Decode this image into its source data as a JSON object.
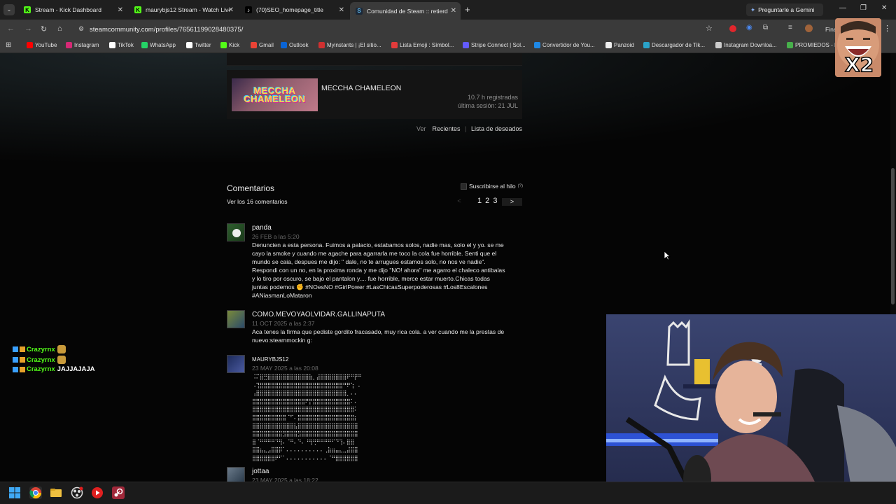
{
  "browser": {
    "tabs": [
      {
        "label": "Stream - Kick Dashboard",
        "favicon": "K",
        "color": "#53fc18"
      },
      {
        "label": "maurybjs12 Stream - Watch Live",
        "favicon": "K",
        "color": "#53fc18"
      },
      {
        "label": "(70)SEO_homepage_title",
        "favicon": "♪",
        "color": "#ffffff"
      },
      {
        "label": "Comunidad de Steam :: retierd",
        "favicon": "S",
        "color": "#66c0f4"
      }
    ],
    "gemini_label": "Preguntarle a Gemini",
    "url": "steamcommunity.com/profiles/76561199028480375/",
    "profile_label": "Fina",
    "bookmarks": [
      {
        "label": "YouTube",
        "color": "#ff0000"
      },
      {
        "label": "Instagram",
        "color": "#d62976"
      },
      {
        "label": "TikTok",
        "color": "#ffffff"
      },
      {
        "label": "WhatsApp",
        "color": "#25d366"
      },
      {
        "label": "Twitter",
        "color": "#ffffff"
      },
      {
        "label": "Kick",
        "color": "#53fc18"
      },
      {
        "label": "Gmail",
        "color": "#ea4335"
      },
      {
        "label": "Outlook",
        "color": "#0a64d6"
      },
      {
        "label": "Myinstants | ¡El sitio...",
        "color": "#d03030"
      },
      {
        "label": "Lista Emoji : Símbol...",
        "color": "#e23b3b"
      },
      {
        "label": "Stripe Connect | Sol...",
        "color": "#635bff"
      },
      {
        "label": "Convertidor de You...",
        "color": "#1e88e5"
      },
      {
        "label": "Panzoid",
        "color": "#eeeeee"
      },
      {
        "label": "Descargador de Tik...",
        "color": "#2aa3c9"
      },
      {
        "label": "Instagram Downloa...",
        "color": "#cccccc"
      },
      {
        "label": "PROMIEDOS - P",
        "color": "#47b04b"
      }
    ]
  },
  "game": {
    "image_text": "MECCHA CHAMELEON",
    "title": "MECCHA CHAMELEON",
    "hours": "10.7 h registradas",
    "last_session": "última sesión: 21 JUL"
  },
  "view_row": {
    "ver": "Ver",
    "recent": "Recientes",
    "wishlist": "Lista de deseados"
  },
  "comments": {
    "title": "Comentarios",
    "subscribe": "Suscribirse al hilo",
    "subscribe_help": "(?)",
    "view_all": "Ver los 16 comentarios",
    "pagination": {
      "prev": "<",
      "pages": "1 2 3",
      "next": ">"
    },
    "items": [
      {
        "author": "panda",
        "date": "26 FEB a las 5:20",
        "lines": [
          "Denuncien a esta persona. Fuimos a palacio, estabamos solos, nadie mas, solo el y yo. se me",
          "cayo la smoke y cuando me agache para agarrarla me toco la cola fue horrible. Senti que el",
          "mundo se caia, despues me dijo: \" dale, no te arrugues estamos solo, no nos ve nadie\".",
          "Respondi con un no, en la proxima ronda y me dijo \"NO! ahora\" me agarro el chaleco antibalas",
          "y lo tiro por oscuro, se bajo el pantalon y.... fue horrible, merce estar muerto.Chicas todas",
          "juntas podemos ✊ #NOesNO #GirlPower #LasChicasSuperpoderosas #Los8Escalones",
          "#ANiasmanLoMataron"
        ]
      },
      {
        "author": "COMO.MEVOYAOLVIDAR.GALLINAPUTA",
        "date": "11 OCT 2025 a las 2:37",
        "lines": [
          "Aca tenes la firma que pediste gordito fracasado, muy rica cola. a ver cuando me la prestas de",
          "nuevo:steammockin g:"
        ]
      },
      {
        "author": "MAURYBJS12",
        "date": "23 MAY 2025 a las 20:08",
        "ascii": [
          "⠨⠍⣿⣛⣿⣿⣿⣿⣿⣿⣿⣿⣿⣿⣿⣷⡀⣼⣿⣿⣿⣿⣿⣿⣿⠟⠛⡟⠛⠀",
          "⠠⢹⣿⣿⣿⣿⣿⣿⣿⣿⣿⣿⣿⣿⣿⣿⣿⣿⣿⣿⣿⣿⣿⣿⠛⠟⢱⠀⠄",
          "⢠⣿⣿⣿⣿⣿⣿⣿⣿⣿⣿⣿⣿⣿⣿⣿⣿⣿⣿⣿⣿⣿⣿⣿⣿⡀⠄⠄",
          "⣿⣿⣿⣿⣿⣿⣿⣿⣿⣿⣿⣿⣿⣿⠟⡟⣿⣿⣿⣿⣿⣿⣿⣿⣿⣿⠅⠄",
          "⣿⣿⣿⣿⣿⣿⣿⣿⣿⣿⣿⣿⣿⣿⣿⣿⣿⣿⣿⣿⣿⣿⣿⣿⣿⣿⣿⠅",
          "⣿⣿⣿⣿⣿⣿⣿⣿⣿⠈⠋⠄⣿⣿⣿⣿⣿⣿⣿⣿⣿⣿⣿⣿⣿⣿⣿⡆",
          "⣿⣿⣿⣿⣿⣿⣿⣿⣿⣿⣿⣧⣿⣿⣿⣿⣿⣿⣿⣿⣿⣿⣿⣿⣿⣿⣿⣿",
          "⣿⣿⣿⣿⣿⣿⣿⣿⣻⣿⣿⣿⣻⣿⣿⣿⣿⣿⣿⣿⣿⣿⣿⣿⣿⣿⣿⣿",
          "⣿⠈⠛⠛⠛⠛⠙⢻⠄⠈⠛⠄⠙⠄⠘⢻⢛⠛⠛⠛⠛⠋⠙⢹⠄⣿⣿",
          "⣿⣿⣦⣄⣠⣿⣿⡿⠁⠄⠄⠄⠄⠄⠄⠄⠄⠄⠄⢀⣷⣶⣤⣄⣀⣼⣿⣿",
          "⣿⣿⣿⣿⣿⣿⠟⠋⠁⠄⠄⠄⠄⠄⠄⠄⠄⠄⠄⠄⠈⠛⣿⣿⣿⣿⣿⣿"
        ]
      },
      {
        "author": "jottaa",
        "date": "23 MAY 2025 a las 18:22"
      }
    ]
  },
  "chat": [
    {
      "user": "Crazyrnx",
      "msg": ""
    },
    {
      "user": "Crazyrnx",
      "msg": ""
    },
    {
      "user": "Crazyrnx",
      "msg": "JAJJAJAJA"
    }
  ],
  "overlay": {
    "facecam_text": "x2"
  }
}
